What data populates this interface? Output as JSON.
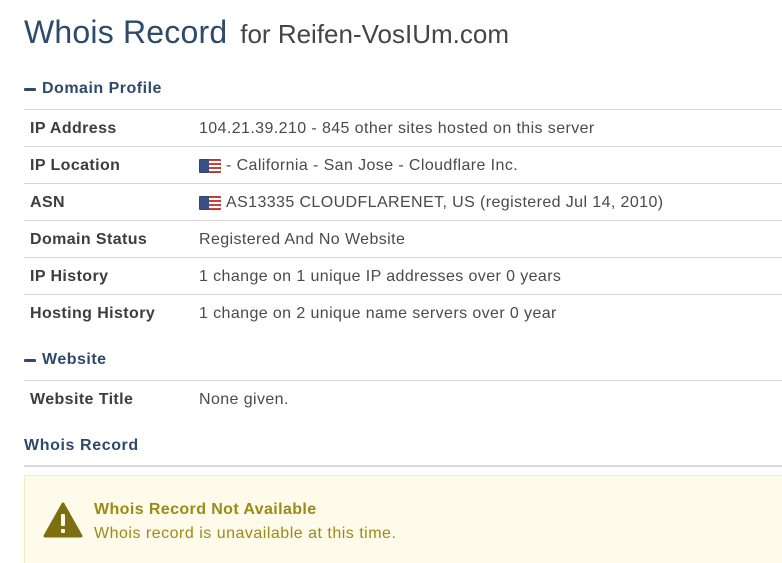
{
  "header": {
    "title": "Whois Record",
    "domain": "for Reifen-VosIUm.com"
  },
  "domain_profile": {
    "heading": "Domain Profile",
    "rows": [
      {
        "label": "IP Address",
        "value": "104.21.39.210 - 845 other sites hosted on this server",
        "flag": false
      },
      {
        "label": "IP Location",
        "value": "- California - San Jose - Cloudflare Inc.",
        "flag": true,
        "flag_icon": "us-flag-icon"
      },
      {
        "label": "ASN",
        "value": "AS13335 CLOUDFLARENET, US (registered Jul 14, 2010)",
        "flag": true,
        "flag_icon": "us-flag-icon"
      },
      {
        "label": "Domain Status",
        "value": "Registered And No Website",
        "flag": false
      },
      {
        "label": "IP History",
        "value": "1 change on 1 unique IP addresses over 0 years",
        "flag": false
      },
      {
        "label": "Hosting History",
        "value": "1 change on 2 unique name servers over 0 year",
        "flag": false
      }
    ]
  },
  "website": {
    "heading": "Website",
    "rows": [
      {
        "label": "Website Title",
        "value": "None given."
      }
    ]
  },
  "whois_record": {
    "heading": "Whois Record",
    "alert": {
      "icon": "warning-icon",
      "title": "Whois Record Not Available",
      "message": "Whois record is unavailable at this time."
    }
  },
  "colors": {
    "heading_blue": "#2d4a6b",
    "alert_background": "#fffbea",
    "alert_text": "#9a8a17"
  }
}
